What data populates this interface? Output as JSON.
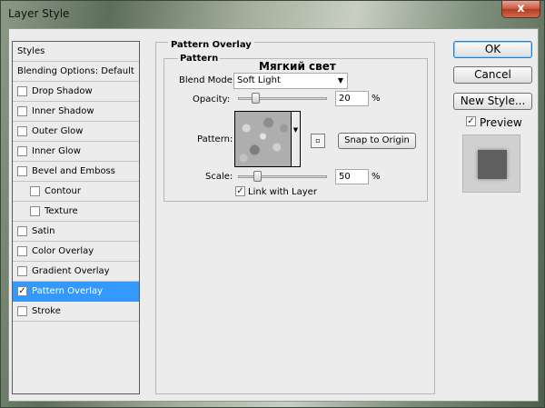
{
  "window": {
    "title": "Layer Style",
    "close_glyph": "x"
  },
  "styles_list": {
    "header_styles": "Styles",
    "header_blending": "Blending Options: Default",
    "items": [
      {
        "label": "Drop Shadow",
        "checked": false
      },
      {
        "label": "Inner Shadow",
        "checked": false
      },
      {
        "label": "Outer Glow",
        "checked": false
      },
      {
        "label": "Inner Glow",
        "checked": false
      },
      {
        "label": "Bevel and Emboss",
        "checked": false
      },
      {
        "label": "Contour",
        "checked": false
      },
      {
        "label": "Texture",
        "checked": false
      },
      {
        "label": "Satin",
        "checked": false
      },
      {
        "label": "Color Overlay",
        "checked": false
      },
      {
        "label": "Gradient Overlay",
        "checked": false
      },
      {
        "label": "Pattern Overlay",
        "checked": true,
        "selected": true
      },
      {
        "label": "Stroke",
        "checked": false
      }
    ]
  },
  "pattern_overlay": {
    "group_title": "Pattern Overlay",
    "subgroup_title": "Pattern",
    "overlay_text": "Мягкий свет",
    "blend_mode_label": "Blend Mode:",
    "blend_mode_value": "Soft Light",
    "opacity_label": "Opacity:",
    "opacity_value": "20",
    "opacity_unit": "%",
    "opacity_fraction": 0.2,
    "pattern_label": "Pattern:",
    "snap_button": "Snap to Origin",
    "scale_label": "Scale:",
    "scale_value": "50",
    "scale_unit": "%",
    "scale_fraction": 0.12,
    "link_label": "Link with Layer",
    "link_checked": true
  },
  "buttons": {
    "ok": "OK",
    "cancel": "Cancel",
    "new_style": "New Style..."
  },
  "preview": {
    "label": "Preview",
    "checked": true
  },
  "colors": {
    "selected_row": "#3399ff",
    "dialog_bg": "#ececec"
  }
}
